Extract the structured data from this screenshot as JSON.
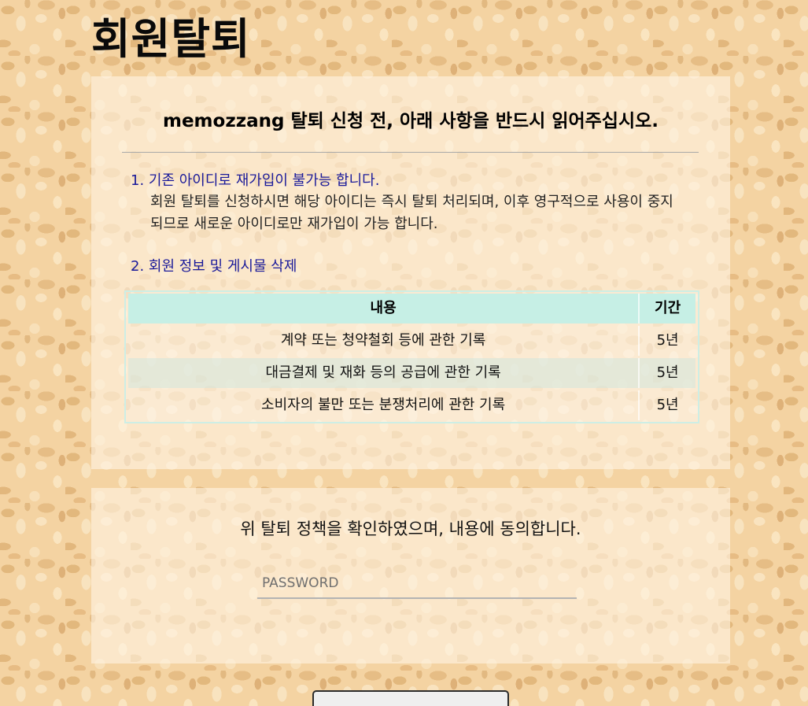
{
  "page": {
    "title": "회원탈퇴"
  },
  "notice": {
    "heading": "memozzang 탈퇴 신청 전, 아래 사항을 반드시 읽어주십시오.",
    "items": [
      {
        "title": "1. 기존 아이디로 재가입이 불가능 합니다.",
        "description": "회원 탈퇴를 신청하시면 해당 아이디는 즉시 탈퇴 처리되며, 이후 영구적으로 사용이 중지되므로 새로운 아이디로만 재가입이 가능 합니다."
      },
      {
        "title": "2. 회원 정보 및 게시물 삭제"
      }
    ],
    "table": {
      "columns": [
        "내용",
        "기간"
      ],
      "rows": [
        [
          "계약 또는 청약철회 등에 관한 기록",
          "5년"
        ],
        [
          "대금결제 및 재화 등의 공급에 관한 기록",
          "5년"
        ],
        [
          "소비자의 불만 또는 분쟁처리에 관한 기록",
          "5년"
        ]
      ]
    }
  },
  "agreement": {
    "text": "위 탈퇴 정책을 확인하였으며, 내용에 동의합니다.",
    "password": {
      "placeholder": "PASSWORD",
      "value": ""
    }
  },
  "colors": {
    "table_header": "#c6efe5",
    "item_title": "#1a1a9a"
  }
}
